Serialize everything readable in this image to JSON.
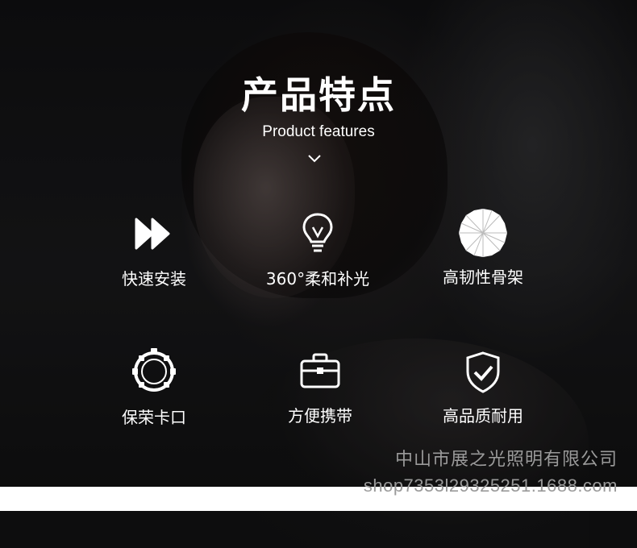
{
  "header": {
    "title": "产品特点",
    "subtitle": "Product features"
  },
  "features": [
    {
      "label": "快速安装",
      "icon": "fast-forward-icon"
    },
    {
      "label": "360°柔和补光",
      "icon": "light-bulb-icon"
    },
    {
      "label": "高韧性骨架",
      "icon": "umbrella-frame-icon"
    },
    {
      "label": "保荣卡口",
      "icon": "bayonet-mount-icon"
    },
    {
      "label": "方便携带",
      "icon": "briefcase-icon"
    },
    {
      "label": "高品质耐用",
      "icon": "shield-check-icon"
    }
  ],
  "watermark": {
    "company": "中山市展之光照明有限公司",
    "shop_url": "shop7353l29325251.1688.com"
  },
  "colors": {
    "text": "#ffffff",
    "background": "#0d0d0e",
    "watermark": "#9a9a9a"
  }
}
